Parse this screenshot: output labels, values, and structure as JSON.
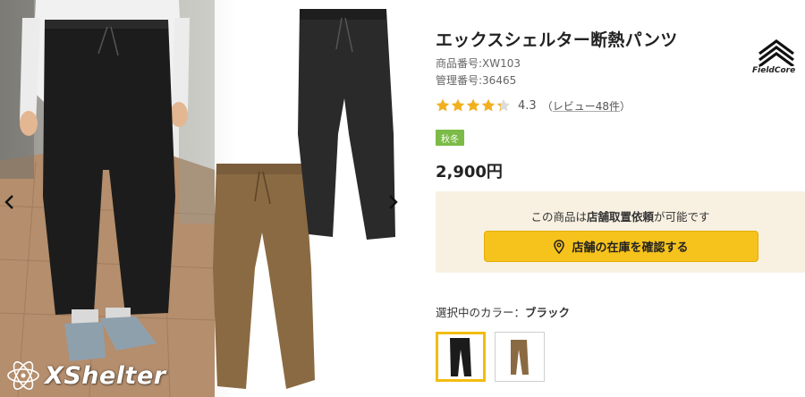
{
  "gallery": {
    "prev_icon": "chevron-left-icon",
    "next_icon": "chevron-right-icon",
    "brand_logo_text": "XShelter",
    "colors": {
      "black_pants": "#1c1c1c",
      "brown_pants": "#8a6a43",
      "stone_floor": "#b48e6d",
      "shoes": "#8fa0ad"
    }
  },
  "product": {
    "title": "エックスシェルター断熱パンツ",
    "product_code": "商品番号:XW103",
    "management_code": "管理番号:36465",
    "maker_logo_text": "FieldCore",
    "rating": {
      "stars": 4.3,
      "score": "4.3",
      "open_paren": "（",
      "reviews_link": "レビュー48件",
      "close_paren": "）",
      "star_color": "#f2b01e"
    },
    "season_badge": "秋冬",
    "price": "2,900円",
    "store": {
      "message_prefix": "この商品は",
      "message_emphasis": "店舗取置依頼",
      "message_suffix": "が可能です",
      "button_label": "店舗の在庫を確認する",
      "button_icon": "location-pin-icon"
    },
    "color_selection": {
      "label": "選択中のカラー：",
      "selected_name": "ブラック",
      "options": [
        {
          "name": "ブラック",
          "color": "#1b1b1b"
        },
        {
          "name": "ブラウン",
          "color": "#8a6a43"
        }
      ]
    }
  }
}
